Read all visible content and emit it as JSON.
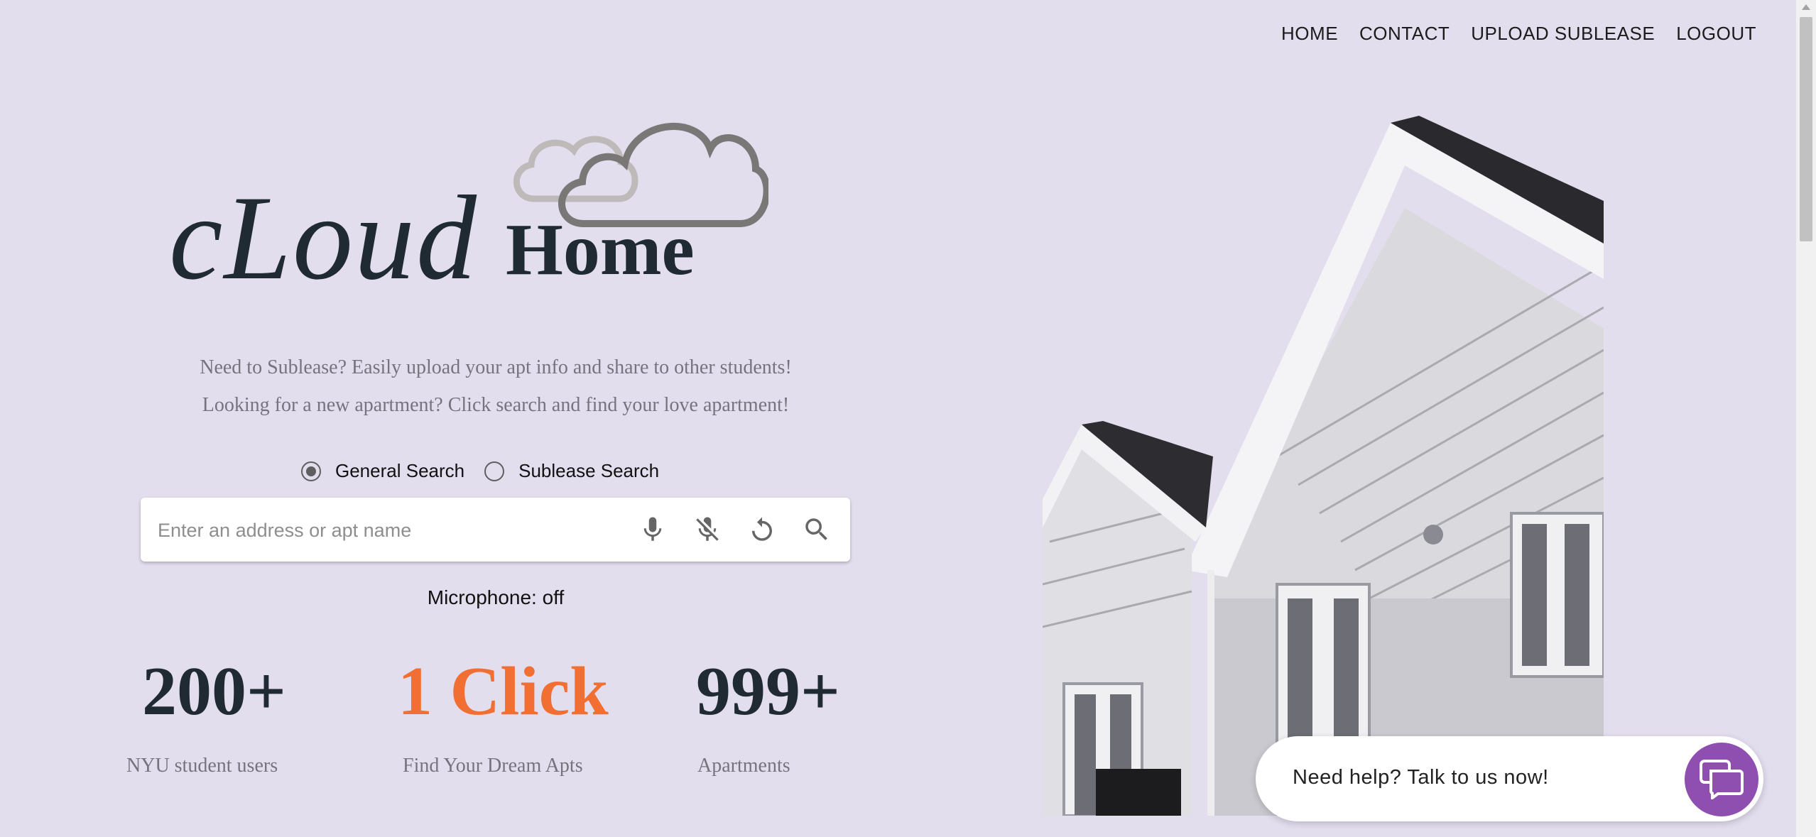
{
  "nav": {
    "items": [
      "HOME",
      "CONTACT",
      "UPLOAD SUBLEASE",
      "LOGOUT"
    ]
  },
  "logo": {
    "part1": "cLoud",
    "part2": "Home"
  },
  "tagline": {
    "line1": "Need to Sublease? Easily upload your apt info and share to other students!",
    "line2": "Looking for a new apartment? Click search and find your love apartment!"
  },
  "search": {
    "modes": [
      {
        "label": "General Search",
        "selected": true
      },
      {
        "label": "Sublease Search",
        "selected": false
      }
    ],
    "placeholder": "Enter an address or apt name",
    "value": "",
    "icons": [
      "microphone-icon",
      "microphone-off-icon",
      "reset-icon",
      "search-icon"
    ]
  },
  "microphone_status": "Microphone: off",
  "stats": [
    {
      "value": "200+",
      "label": "NYU student users"
    },
    {
      "value": "1 Click",
      "label": "Find Your Dream Apts"
    },
    {
      "value": "999+",
      "label": "Apartments"
    }
  ],
  "chat": {
    "prompt": "Need help? Talk to us now!"
  },
  "colors": {
    "background": "#e3deee",
    "accent_orange": "#f26f33",
    "chat_purple": "#8e4fb0",
    "heading_dark": "#1f2a32"
  }
}
